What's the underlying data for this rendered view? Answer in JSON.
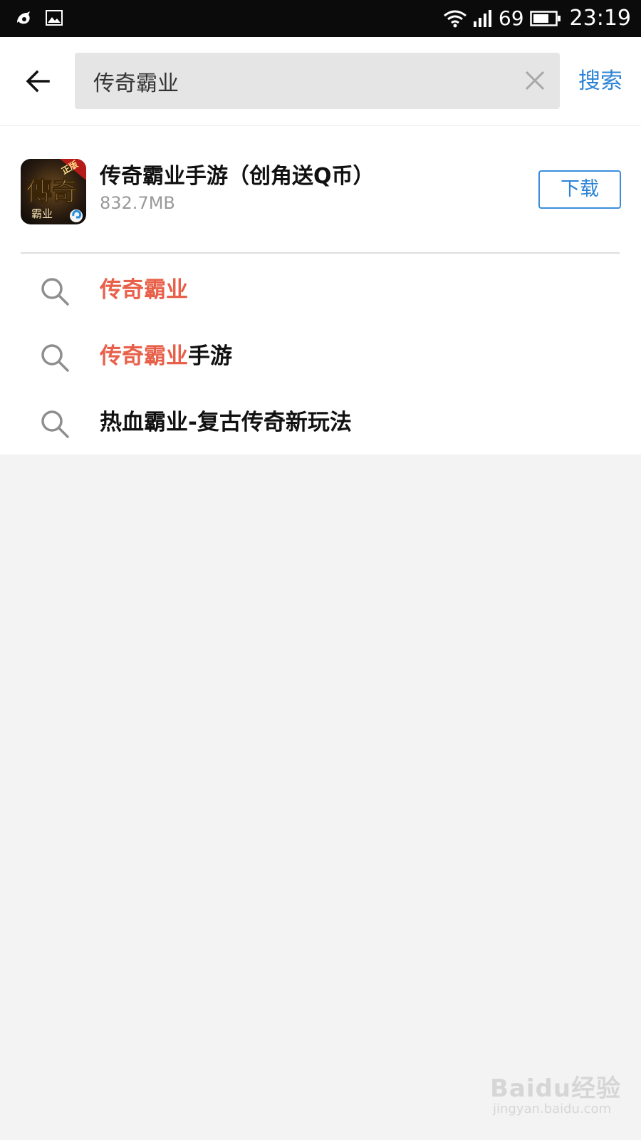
{
  "status_bar": {
    "signal_strength": "69",
    "time": "23:19",
    "left_icons": [
      "uc-browser-icon",
      "image-icon"
    ],
    "right_icons": [
      "wifi-icon",
      "cellular-signal-icon",
      "battery-icon"
    ]
  },
  "search": {
    "query": "传奇霸业",
    "submit_label": "搜索"
  },
  "app_result": {
    "name": "传奇霸业手游（创角送Q币）",
    "size": "832.7MB",
    "download_label": "下载",
    "icon_text_main": "傳奇",
    "icon_text_sub": "霸业",
    "icon_badge": "正版"
  },
  "suggestions": [
    {
      "highlight": "传奇霸业",
      "rest": ""
    },
    {
      "highlight": "传奇霸业",
      "rest": "手游"
    },
    {
      "highlight": "",
      "rest": "热血霸业-复古传奇新玩法"
    }
  ],
  "watermark": {
    "main": "Baidu经验",
    "sub": "jingyan.baidu.com"
  },
  "colors": {
    "accent_blue": "#2d84d6",
    "highlight_red": "#e8604a",
    "search_box_bg": "#e5e5e5",
    "page_bg": "#f3f3f3"
  }
}
